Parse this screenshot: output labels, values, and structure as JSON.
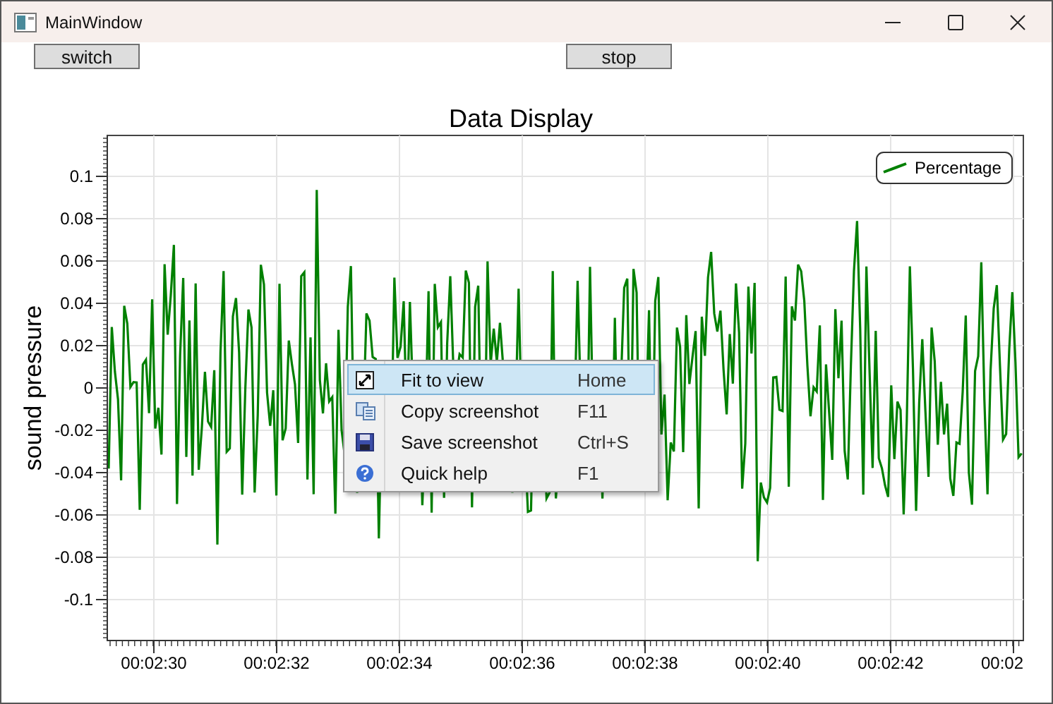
{
  "window": {
    "title": "MainWindow"
  },
  "buttons": [
    "switch",
    "stop"
  ],
  "chart": {
    "title": "Data Display",
    "ylabel": "sound pressure",
    "y_ticks": [
      "0.1",
      "0.08",
      "0.06",
      "0.04",
      "0.02",
      "0",
      "-0.02",
      "-0.04",
      "-0.06",
      "-0.08",
      "-0.1"
    ],
    "x_ticks": [
      "00:02:30",
      "00:02:32",
      "00:02:34",
      "00:02:36",
      "00:02:38",
      "00:02:40",
      "00:02:42",
      "00:02"
    ],
    "legend": {
      "label": "Percentage"
    }
  },
  "context_menu": {
    "items": [
      {
        "label": "Fit to view",
        "shortcut": "Home",
        "selected": true
      },
      {
        "label": "Copy screenshot",
        "shortcut": "F11",
        "selected": false
      },
      {
        "label": "Save screenshot",
        "shortcut": "Ctrl+S",
        "selected": false
      },
      {
        "label": "Quick help",
        "shortcut": "F1",
        "selected": false
      }
    ]
  }
}
